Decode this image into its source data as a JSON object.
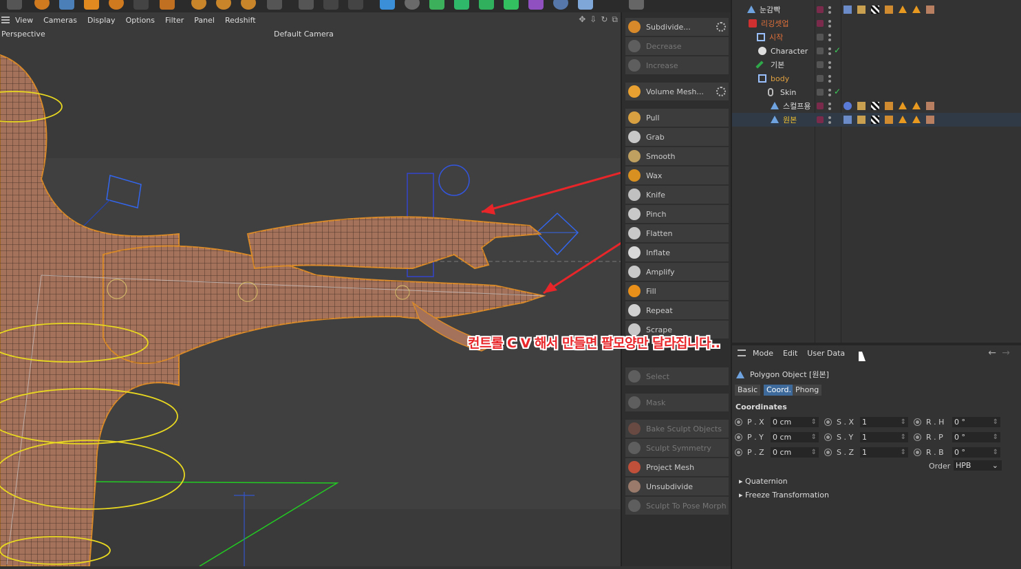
{
  "viewport": {
    "menu": [
      "View",
      "Cameras",
      "Display",
      "Options",
      "Filter",
      "Panel",
      "Redshift"
    ],
    "projection_label": "Perspective",
    "camera_label": "Default Camera"
  },
  "sculpt_panel": {
    "buttons": [
      {
        "label": "Subdivide...",
        "enabled": true
      },
      {
        "label": "Decrease",
        "enabled": false
      },
      {
        "label": "Increase",
        "enabled": false
      },
      {
        "label": "Volume Mesh...",
        "enabled": true
      },
      {
        "label": "Pull",
        "enabled": true
      },
      {
        "label": "Grab",
        "enabled": true
      },
      {
        "label": "Smooth",
        "enabled": true
      },
      {
        "label": "Wax",
        "enabled": true
      },
      {
        "label": "Knife",
        "enabled": true
      },
      {
        "label": "Pinch",
        "enabled": true
      },
      {
        "label": "Flatten",
        "enabled": true
      },
      {
        "label": "Inflate",
        "enabled": true
      },
      {
        "label": "Amplify",
        "enabled": true
      },
      {
        "label": "Fill",
        "enabled": true
      },
      {
        "label": "Repeat",
        "enabled": true
      },
      {
        "label": "Scrape",
        "enabled": true
      },
      {
        "label": "Select",
        "enabled": false
      },
      {
        "label": "Mask",
        "enabled": false
      },
      {
        "label": "Bake Sculpt Objects",
        "enabled": false
      },
      {
        "label": "Sculpt Symmetry",
        "enabled": false
      },
      {
        "label": "Project Mesh",
        "enabled": true
      },
      {
        "label": "Unsubdivide",
        "enabled": true
      },
      {
        "label": "Sculpt To Pose Morph",
        "enabled": false
      }
    ]
  },
  "object_manager": {
    "rows": [
      {
        "name": "눈감빡",
        "color": "#dddddd"
      },
      {
        "name": "리깅셋업",
        "color": "#e0703a"
      },
      {
        "name": "시작",
        "color": "#e0703a"
      },
      {
        "name": "Character",
        "color": "#dddddd"
      },
      {
        "name": "기본",
        "color": "#dddddd"
      },
      {
        "name": "body",
        "color": "#e0a040"
      },
      {
        "name": "Skin",
        "color": "#dddddd"
      },
      {
        "name": "스컬프용",
        "color": "#dddddd"
      },
      {
        "name": "원본",
        "color": "#f0c030"
      }
    ]
  },
  "attribute_manager": {
    "menu": [
      "Mode",
      "Edit",
      "User Data"
    ],
    "object_title": "Polygon Object [원본]",
    "tabs": [
      {
        "label": "Basic",
        "active": false
      },
      {
        "label": "Coord.",
        "active": true
      },
      {
        "label": "Phong",
        "active": false
      }
    ],
    "section": "Coordinates",
    "position": [
      {
        "label": "P . X",
        "value": "0 cm"
      },
      {
        "label": "P . Y",
        "value": "0 cm"
      },
      {
        "label": "P . Z",
        "value": "0 cm"
      }
    ],
    "scale": [
      {
        "label": "S . X",
        "value": "1"
      },
      {
        "label": "S . Y",
        "value": "1"
      },
      {
        "label": "S . Z",
        "value": "1"
      }
    ],
    "rotation": [
      {
        "label": "R . H",
        "value": "0 °"
      },
      {
        "label": "R . P",
        "value": "0 °"
      },
      {
        "label": "R . B",
        "value": "0 °"
      }
    ],
    "order_label": "Order",
    "order_value": "HPB",
    "collapsed": [
      "Quaternion",
      "Freeze Transformation"
    ]
  },
  "annotation": {
    "caption": "컨트롤 C V 해서 만들면 팔모양만 달라집니다..",
    "color": "#e8262a"
  },
  "colors": {
    "accent_tab": "#3d6a9a",
    "mesh_skin": "#a4715a",
    "selection_outline": "#d98a2a"
  }
}
